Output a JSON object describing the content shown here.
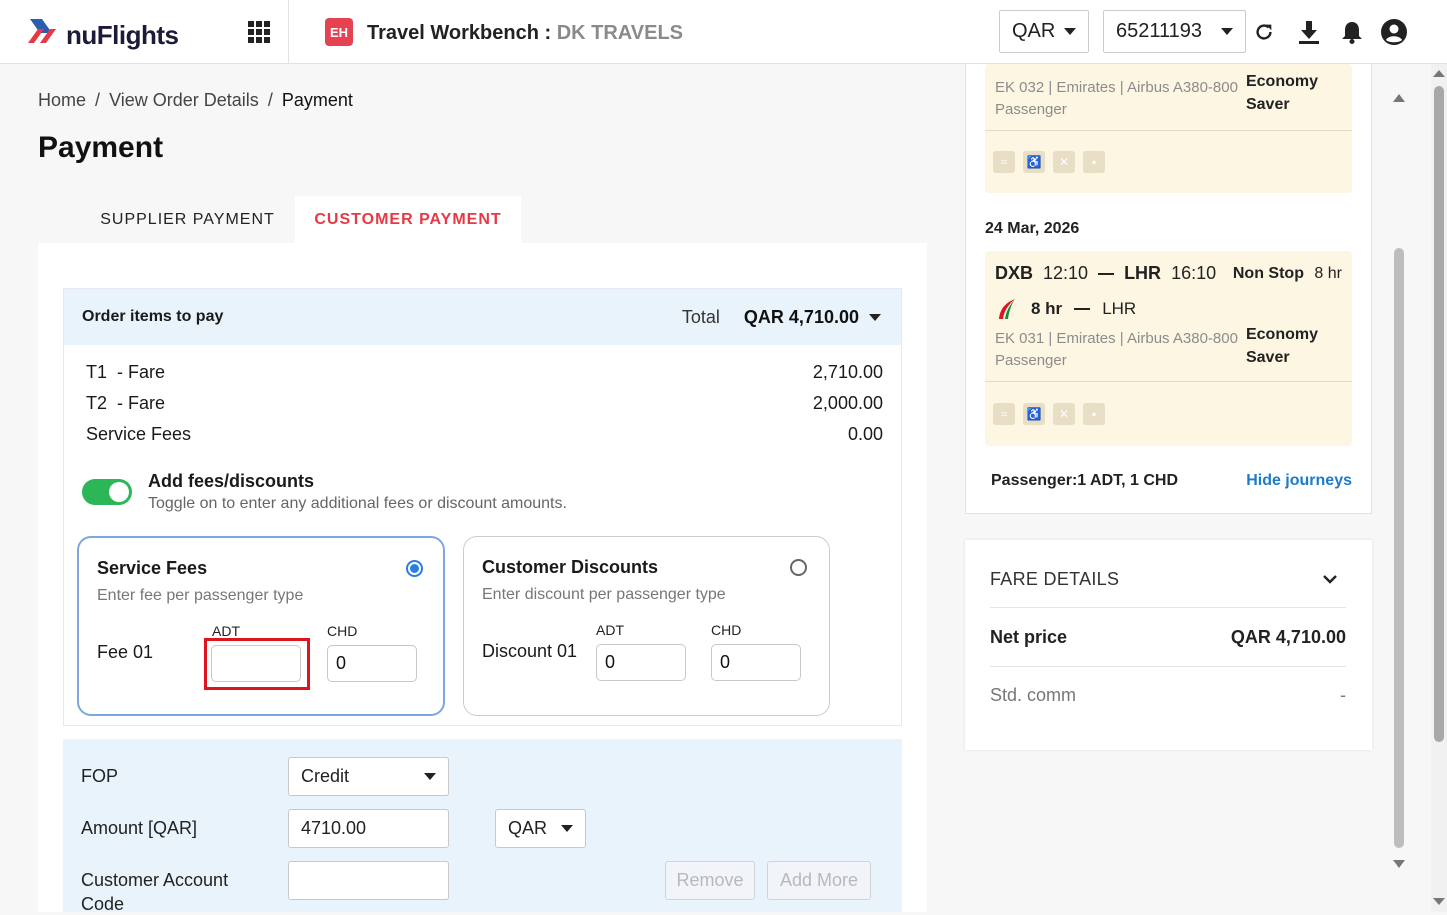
{
  "header": {
    "brand": "nuFlights",
    "workbench_icon_text": "EH",
    "workbench_title": "Travel Workbench :",
    "agency": "DK TRAVELS",
    "currency": "QAR",
    "account": "65211193"
  },
  "breadcrumb": {
    "home": "Home",
    "sep1": "/",
    "view_order": "View Order Details",
    "sep2": "/",
    "current": "Payment"
  },
  "page_title": "Payment",
  "tabs": {
    "supplier": "SUPPLIER PAYMENT",
    "customer": "CUSTOMER PAYMENT",
    "active": "customer"
  },
  "order": {
    "label": "Order items to pay",
    "total_label": "Total",
    "total_amount": "QAR 4,710.00",
    "items": [
      {
        "label": "T1  - Fare",
        "amount": "2,710.00"
      },
      {
        "label": "T2  - Fare",
        "amount": "2,000.00"
      },
      {
        "label": "Service Fees",
        "amount": "0.00"
      }
    ]
  },
  "fees_toggle": {
    "on": true,
    "title": "Add fees/discounts",
    "subtitle": "Toggle on to enter any additional fees or discount amounts."
  },
  "service_fees": {
    "title": "Service Fees",
    "subtitle": "Enter fee per passenger type",
    "selected": true,
    "row_label": "Fee 01",
    "adt_label": "ADT",
    "chd_label": "CHD",
    "adt_value": "",
    "chd_value": "0"
  },
  "customer_discounts": {
    "title": "Customer Discounts",
    "subtitle": "Enter discount per passenger type",
    "selected": false,
    "row_label": "Discount 01",
    "adt_label": "ADT",
    "chd_label": "CHD",
    "adt_value": "0",
    "chd_value": "0"
  },
  "payment_form": {
    "fop_label": "FOP",
    "fop_value": "Credit",
    "amount_label": "Amount [QAR]",
    "amount_value": "4710.00",
    "amount_currency": "QAR",
    "account_code_label_1": "Customer Account",
    "account_code_label_2": "Code",
    "account_code_value": "",
    "remove_label": "Remove",
    "add_more_label": "Add More"
  },
  "journey": {
    "segment_top": {
      "flight_info": "EK 032 | Emirates | Airbus A380-800",
      "passenger": "Passenger",
      "cabin_line1": "Economy",
      "cabin_line2": "Saver"
    },
    "date": "24 Mar, 2026",
    "segment": {
      "origin": "DXB",
      "dep_time": "12:10",
      "destination": "LHR",
      "arr_time": "16:10",
      "stops": "Non Stop",
      "duration": "8 hr",
      "leg_duration": "8 hr",
      "leg_dest": "LHR",
      "flight_info": "EK 031 | Emirates | Airbus A380-800",
      "passenger": "Passenger",
      "cabin_line1": "Economy",
      "cabin_line2": "Saver"
    },
    "passengers": "Passenger:1 ADT, 1 CHD",
    "hide_label": "Hide journeys"
  },
  "fare_details": {
    "title": "FARE DETAILS",
    "net_label": "Net price",
    "net_value": "QAR 4,710.00",
    "comm_label": "Std. comm",
    "comm_value": "-"
  },
  "colors": {
    "accent": "#e53945",
    "link": "#1e7bc8",
    "toggle": "#2db657",
    "highlight": "#e0141e"
  }
}
